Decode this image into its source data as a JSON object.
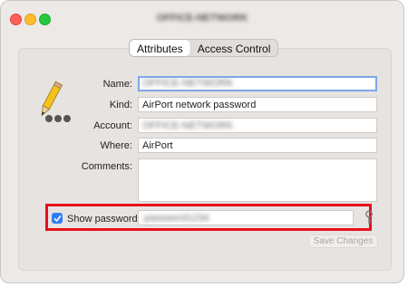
{
  "window": {
    "title": "OFFICE-NETWORK"
  },
  "tabs": [
    {
      "label": "Attributes",
      "active": true
    },
    {
      "label": "Access Control",
      "active": false
    }
  ],
  "form": {
    "name_label": "Name:",
    "name_value": "OFFICE-NETWORK",
    "kind_label": "Kind:",
    "kind_value": "AirPort network password",
    "account_label": "Account:",
    "account_value": "OFFICE-NETWORK",
    "where_label": "Where:",
    "where_value": "AirPort",
    "comments_label": "Comments:",
    "comments_value": ""
  },
  "password": {
    "show_checked": true,
    "show_label": "Show password:",
    "value": "password1234"
  },
  "buttons": {
    "save_label": "Save Changes"
  },
  "colors": {
    "highlight": "#e8101b",
    "checkbox": "#2f7df6",
    "focus_ring": "#7ea6e6"
  }
}
